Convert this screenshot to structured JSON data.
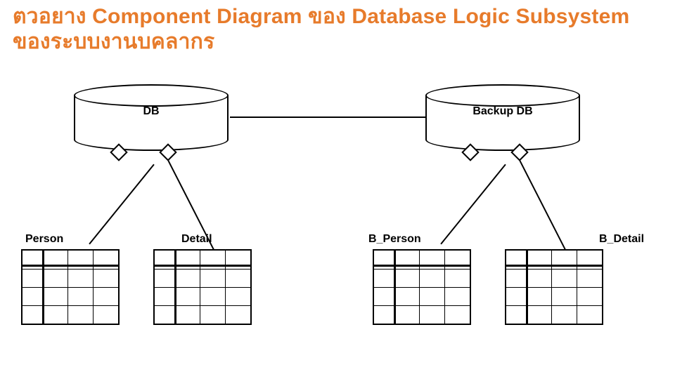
{
  "title": "ตวอยาง    Component Diagram ของ Database Logic Subsystem ของระบบงานบคลากร",
  "databases": {
    "left": {
      "label": "DB"
    },
    "right": {
      "label": "Backup DB"
    }
  },
  "tables": {
    "t1": {
      "label": "Person"
    },
    "t2": {
      "label": "Detail"
    },
    "t3": {
      "label": "B_Person"
    },
    "t4": {
      "label": "B_Detail"
    }
  }
}
